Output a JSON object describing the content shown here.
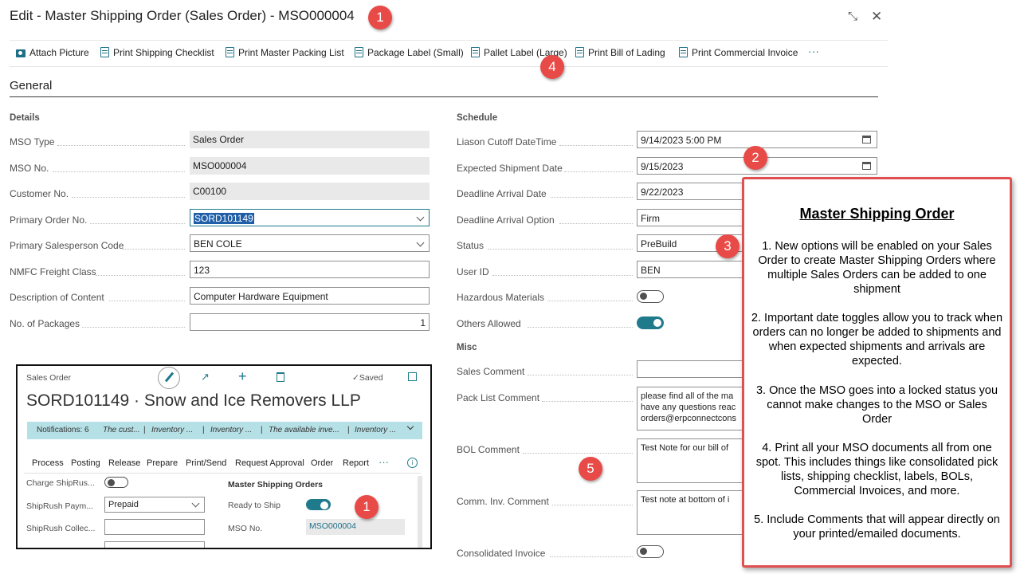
{
  "window": {
    "title": "Edit - Master Shipping Order (Sales Order) - MSO000004",
    "collapse_icon": "collapse-arrows-icon",
    "close_icon": "close-icon",
    "collapse_glyph": "⤡",
    "close_glyph": "✕"
  },
  "toolbar": {
    "items": [
      {
        "label": "Attach Picture",
        "icon": "picture-icon"
      },
      {
        "label": "Print Shipping Checklist",
        "icon": "print-doc-icon"
      },
      {
        "label": "Print Master Packing List",
        "icon": "print-doc-icon"
      },
      {
        "label": "Package Label (Small)",
        "icon": "print-doc-icon"
      },
      {
        "label": "Pallet Label (Large)",
        "icon": "print-doc-icon"
      },
      {
        "label": "Print Bill of Lading",
        "icon": "print-doc-icon"
      },
      {
        "label": "Print Commercial Invoice",
        "icon": "print-doc-icon"
      }
    ],
    "more": "···"
  },
  "general": {
    "title": "General",
    "details": {
      "title": "Details",
      "fields": [
        {
          "label": "MSO Type",
          "value": "Sales Order"
        },
        {
          "label": "MSO No.",
          "value": "MSO000004"
        },
        {
          "label": "Customer No.",
          "value": "C00100"
        },
        {
          "label": "Primary Order No.",
          "value": "SORD101149"
        },
        {
          "label": "Primary Salesperson Code",
          "value": "BEN COLE"
        },
        {
          "label": "NMFC Freight Class",
          "value": "123"
        },
        {
          "label": "Description of Content",
          "value": "Computer Hardware Equipment"
        },
        {
          "label": "No. of Packages",
          "value": "1"
        }
      ]
    },
    "schedule": {
      "title": "Schedule",
      "fields": [
        {
          "label": "Liason Cutoff DateTime",
          "value": "9/14/2023 5:00 PM"
        },
        {
          "label": "Expected Shipment Date",
          "value": "9/15/2023"
        },
        {
          "label": "Deadline Arrival Date",
          "value": "9/22/2023"
        },
        {
          "label": "Deadline Arrival Option",
          "value": "Firm"
        },
        {
          "label": "Status",
          "value": "PreBuild"
        },
        {
          "label": "User ID",
          "value": "BEN"
        },
        {
          "label": "Hazardous Materials",
          "value": "off"
        },
        {
          "label": "Others Allowed",
          "value": "on"
        }
      ]
    },
    "misc": {
      "title": "Misc",
      "fields": [
        {
          "label": "Sales Comment",
          "value": ""
        },
        {
          "label": "Pack List Comment",
          "value": "please find all of the ma\nhave any questions reac\norders@erpconnectcons"
        },
        {
          "label": "BOL Comment",
          "value": "Test Note for our bill of"
        },
        {
          "label": "Comm. Inv. Comment",
          "value": "Test note at bottom of i"
        },
        {
          "label": "Consolidated Invoice",
          "value": "off"
        }
      ]
    }
  },
  "inset": {
    "caption": "Sales Order",
    "saved": "Saved",
    "saved_check": "✓",
    "title": "SORD101149 · Snow and Ice Removers LLP",
    "notifications": [
      "Notifications: 6",
      "The cust...",
      "|",
      "Inventory ...",
      "|",
      "Inventory ...",
      "|",
      "The available inve...",
      "|",
      "Inventory ..."
    ],
    "menu": [
      "Process",
      "Posting",
      "Release",
      "Prepare",
      "Print/Send",
      "Request Approval",
      "Order",
      "Report",
      "···"
    ],
    "left_fields": [
      {
        "label": "Charge ShipRus...",
        "value": "off"
      },
      {
        "label": "ShipRush Paym...",
        "value": "Prepaid"
      },
      {
        "label": "ShipRush Collec...",
        "value": ""
      },
      {
        "label": "",
        "value": ""
      }
    ],
    "group_title": "Master Shipping Orders",
    "right_fields": [
      {
        "label": "Ready to Ship",
        "value": "on"
      },
      {
        "label": "MSO No.",
        "value": "MSO000004"
      }
    ]
  },
  "callout": {
    "title": "Master Shipping Order",
    "points": [
      "1. New options will be enabled on your Sales Order to create Master Shipping Orders where multiple Sales Orders can be added to one shipment",
      "2. Important date toggles allow you to track when orders can no longer be added to shipments and when expected shipments and arrivals are expected.",
      "3. Once the MSO goes into a locked status you cannot make changes to the MSO or Sales Order",
      "4. Print all your MSO documents all from one spot. This includes things like consolidated pick lists, shipping checklist, labels, BOLs, Commercial Invoices, and more.",
      "5. Include Comments that will appear directly on your printed/emailed documents."
    ]
  },
  "badges": [
    "1",
    "2",
    "3",
    "4",
    "5",
    "1"
  ],
  "colors": {
    "accent": "#1f7a8c",
    "badge": "#e84a47",
    "callout_border": "#e05050",
    "notification_bar": "#b5e0e5"
  }
}
